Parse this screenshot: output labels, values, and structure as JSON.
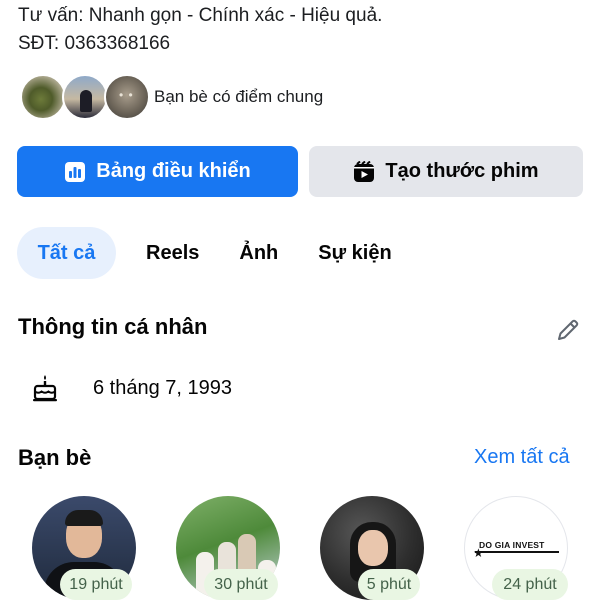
{
  "profile": {
    "bio_line1": "Tư vấn: Nhanh gọn - Chính xác - Hiệu quả.",
    "bio_line2": "SĐT: 0363368166"
  },
  "mutual_friends": {
    "label": "Bạn bè có điểm chung"
  },
  "actions": {
    "dashboard_label": "Bảng điều khiển",
    "create_reel_label": "Tạo thước phim",
    "dashboard_icon": "bar-chart-icon",
    "create_reel_icon": "reel-icon"
  },
  "tabs": [
    {
      "label": "Tất cả",
      "active": true
    },
    {
      "label": "Reels",
      "active": false
    },
    {
      "label": "Ảnh",
      "active": false
    },
    {
      "label": "Sự kiện",
      "active": false
    }
  ],
  "personal_info": {
    "title": "Thông tin cá nhân",
    "birthday": "6 tháng 7, 1993"
  },
  "friends": {
    "title": "Bạn bè",
    "see_all": "Xem tất cả",
    "items": [
      {
        "badge": "19 phút"
      },
      {
        "badge": "30 phút"
      },
      {
        "badge": "5 phút"
      },
      {
        "badge": "24 phút",
        "logo_text": "DO GIA INVEST"
      }
    ]
  },
  "colors": {
    "primary": "#1877f2",
    "secondary_button": "#e4e6eb",
    "active_tab_bg": "#e7f0fd",
    "badge_bg": "#e9f6e3"
  }
}
